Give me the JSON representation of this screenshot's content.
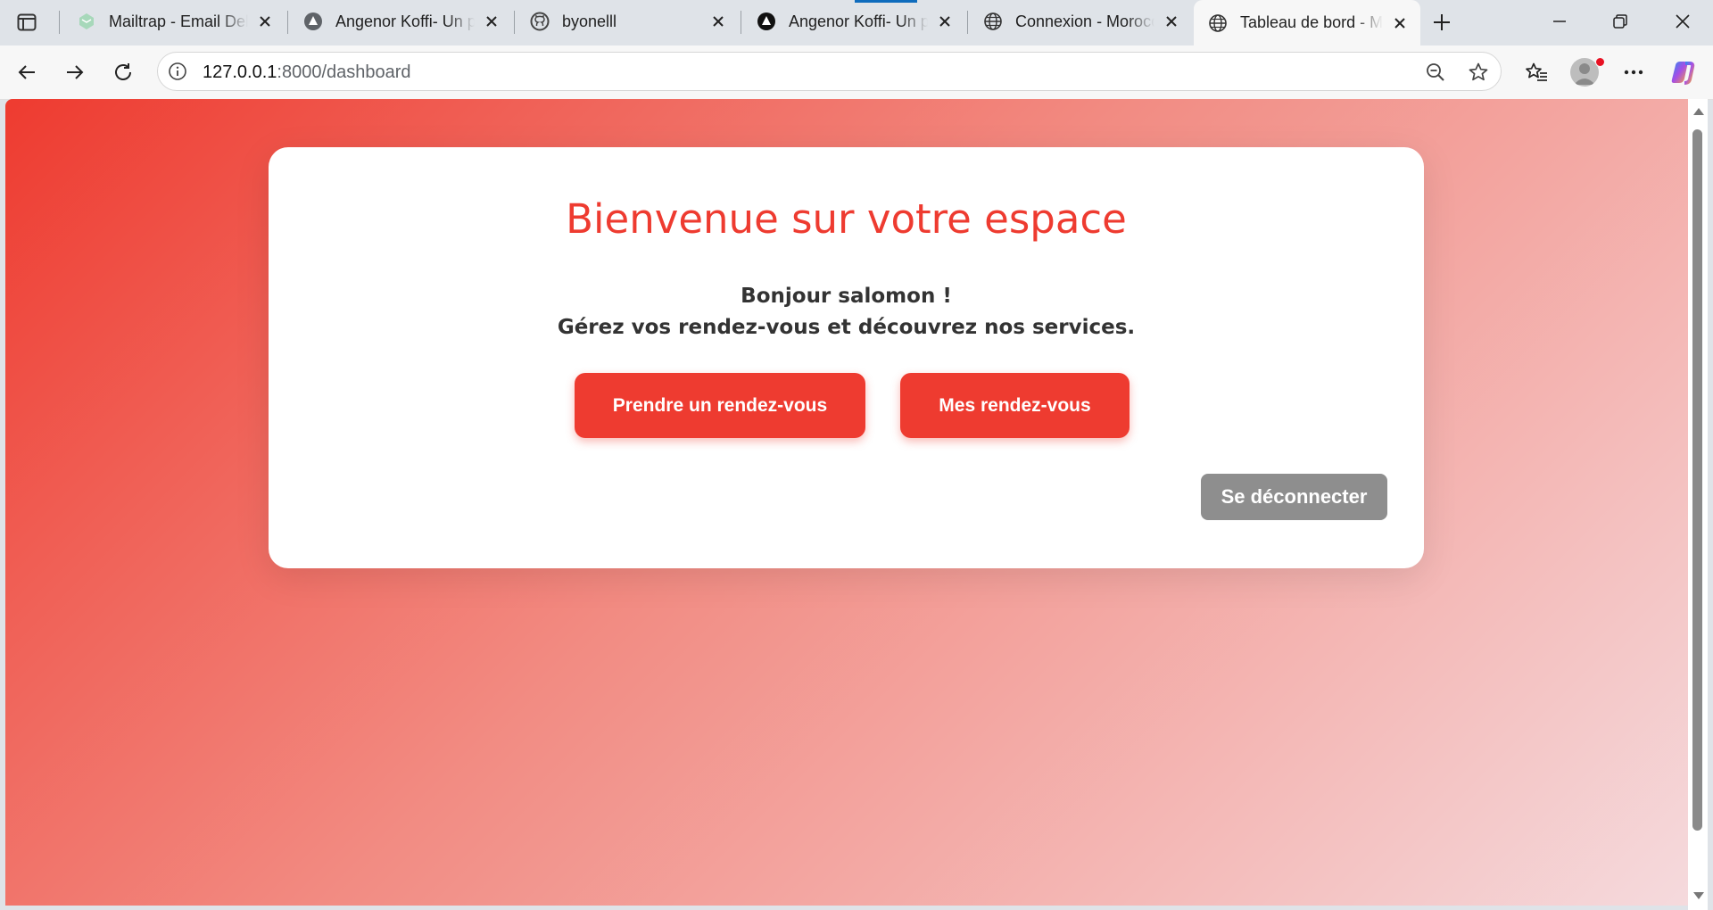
{
  "browser": {
    "tabs": [
      {
        "title": "Mailtrap - Email Delivery Platform",
        "icon": "mailtrap-icon",
        "active": false
      },
      {
        "title": "Angenor Koffi- Un portfolio",
        "icon": "angenor-icon",
        "active": false
      },
      {
        "title": "byonelll",
        "icon": "github-icon",
        "active": false
      },
      {
        "title": "Angenor Koffi- Un portfolio",
        "icon": "angenor-icon",
        "active": false
      },
      {
        "title": "Connexion - Morocco",
        "icon": "globe-icon",
        "active": false
      },
      {
        "title": "Tableau de bord - Morocco",
        "icon": "globe-icon",
        "active": true
      }
    ],
    "address": {
      "host": "127.0.0.1",
      "path": ":8000/dashboard"
    }
  },
  "page": {
    "heading": "Bienvenue sur votre espace",
    "greeting": "Bonjour salomon !",
    "subtitle": "Gérez vos rendez-vous et découvrez nos services.",
    "buttons": {
      "book": "Prendre un rendez-vous",
      "mine": "Mes rendez-vous",
      "logout": "Se déconnecter"
    }
  },
  "colors": {
    "accent": "#ee3b30",
    "logout": "#8e8e8e",
    "gradient_start": "#ee3b30",
    "gradient_end": "#f5dadd"
  }
}
